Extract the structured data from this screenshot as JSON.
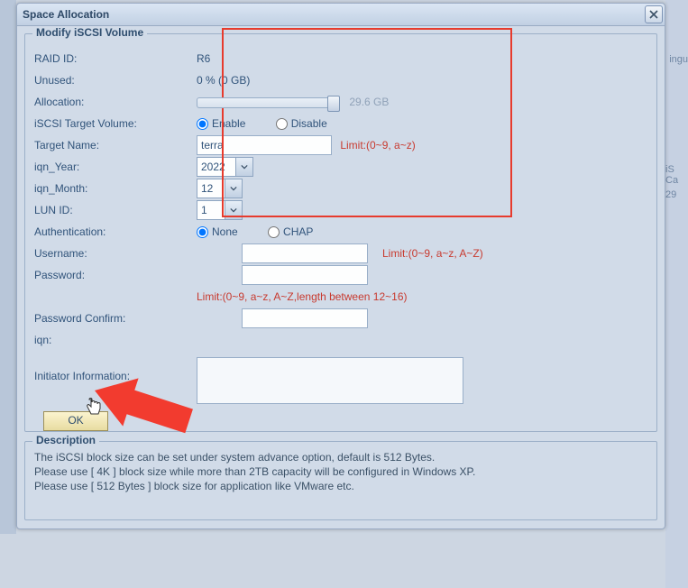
{
  "window": {
    "title": "Space Allocation"
  },
  "fieldset1": {
    "legend": "Modify iSCSI Volume"
  },
  "raid": {
    "label": "RAID ID:",
    "value": "R6"
  },
  "unused": {
    "label": "Unused:",
    "value": "0 % (0 GB)"
  },
  "alloc": {
    "label": "Allocation:",
    "value": "29.6 GB"
  },
  "target": {
    "label": "iSCSI Target Volume:",
    "enable": "Enable",
    "disable": "Disable"
  },
  "tname": {
    "label": "Target Name:",
    "value": "terra",
    "limit": "Limit:(0~9, a~z)"
  },
  "year": {
    "label": "iqn_Year:",
    "value": "2022"
  },
  "month": {
    "label": "iqn_Month:",
    "value": "12"
  },
  "lun": {
    "label": "LUN ID:",
    "value": "1"
  },
  "auth": {
    "label": "Authentication:",
    "none": "None",
    "chap": "CHAP"
  },
  "user": {
    "label": "Username:",
    "value": "",
    "limit": "Limit:(0~9, a~z, A~Z)"
  },
  "pass": {
    "label": "Password:",
    "value": "",
    "limit": "Limit:(0~9, a~z, A~Z,length between 12~16)"
  },
  "passc": {
    "label": "Password Confirm:",
    "value": ""
  },
  "iqn": {
    "label": "iqn:"
  },
  "init": {
    "label": "Initiator Information:",
    "value": ""
  },
  "ok": {
    "label": "OK"
  },
  "desc": {
    "legend": "Description",
    "line1": "The iSCSI block size can be set under system advance option, default is 512 Bytes.",
    "line2": "Please use [ 4K ] block size while more than 2TB capacity will be configured in Windows XP.",
    "line3": "Please use [ 512 Bytes ] block size for application like VMware etc."
  },
  "bgright": {
    "a": "ingu",
    "b": "iS",
    "c": "Ca",
    "d": "29"
  }
}
